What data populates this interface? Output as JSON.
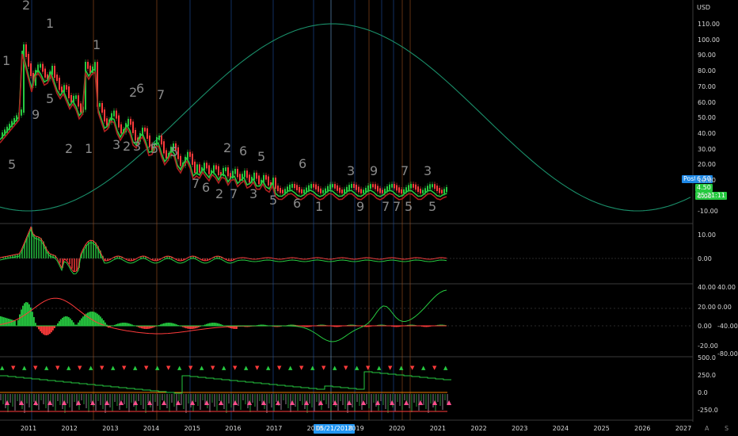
{
  "currency": "USD",
  "main_axis": [
    "110.00",
    "100.00",
    "90.00",
    "80.00",
    "70.00",
    "60.00",
    "50.00",
    "40.00",
    "30.00",
    "20.00",
    "10.00",
    "0.00",
    "-10.00"
  ],
  "pane2_axis": [
    "10.00",
    "0.00"
  ],
  "pane3_axis_left": [
    "40.00",
    "20.00",
    "0.00",
    "-20.00"
  ],
  "pane3_axis_right": [
    "40.00",
    "0.00",
    "-40.00",
    "-80.00"
  ],
  "pane4_axis": [
    "500.0",
    "250.0",
    "0.0",
    "-250.0"
  ],
  "years": [
    "2011",
    "2012",
    "2013",
    "2014",
    "2015",
    "2016",
    "2017",
    "2018",
    "2019",
    "2020",
    "2021",
    "2022",
    "2023",
    "2024",
    "2025",
    "2026",
    "2027"
  ],
  "crosshair_date": "05/21/2018",
  "last_price_tag": {
    "label": "Post",
    "value": "6.50"
  },
  "price_tag_2": "4.50",
  "price_tag_3": "25:21:11",
  "footer_buttons": {
    "auto": "A",
    "scale": "S"
  },
  "colors": {
    "up": "#26c940",
    "down": "#ff3b3b",
    "curve": "#1a8f6a",
    "accent": "#2196f3"
  }
}
